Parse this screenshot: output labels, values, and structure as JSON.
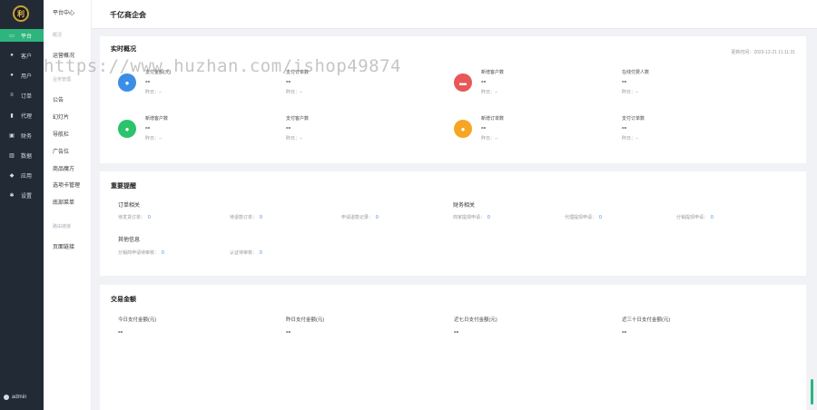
{
  "nav": {
    "logo_text": "利",
    "items": [
      {
        "label": "平台",
        "icon": "monitor-icon"
      },
      {
        "label": "客户",
        "icon": "user-icon"
      },
      {
        "label": "用户",
        "icon": "users-icon"
      },
      {
        "label": "订单",
        "icon": "list-icon"
      },
      {
        "label": "代理",
        "icon": "flag-icon"
      },
      {
        "label": "财务",
        "icon": "wallet-icon"
      },
      {
        "label": "数据",
        "icon": "chart-icon"
      },
      {
        "label": "应用",
        "icon": "apps-icon"
      },
      {
        "label": "设置",
        "icon": "gear-icon"
      }
    ],
    "user": "admin"
  },
  "submenu": {
    "top": "平台中心",
    "group1": "概况",
    "overview": "运营概况",
    "group2": "业务管理",
    "items": [
      "公告",
      "幻灯片",
      "导航栏",
      "广告位",
      "商品魔方",
      "选项卡管理",
      "底部菜单"
    ],
    "group3": "路由链接",
    "link": "页面链接"
  },
  "header": {
    "title": "千亿商企会"
  },
  "realtime": {
    "title": "实时概况",
    "updated": "更新时间：2023-12-21 11:11:31",
    "stats": [
      {
        "label": "支付金额(元)",
        "value": "--",
        "yesterday": "昨日：--",
        "icon": "money-bag-icon",
        "color": "#3a8ee6"
      },
      {
        "label": "支付订单数",
        "value": "--",
        "yesterday": "昨日：--"
      },
      {
        "label": "新增客户数",
        "value": "--",
        "yesterday": "昨日：--",
        "icon": "store-icon",
        "color": "#e85858"
      },
      {
        "label": "在线付费人数",
        "value": "--",
        "yesterday": "昨日：--"
      },
      {
        "label": "新增客户数",
        "value": "--",
        "yesterday": "昨日：--",
        "icon": "person-icon",
        "color": "#2bc36b"
      },
      {
        "label": "支付客户数",
        "value": "--",
        "yesterday": "昨日：--"
      },
      {
        "label": "新增订单数",
        "value": "--",
        "yesterday": "昨日：--",
        "icon": "people-icon",
        "color": "#f5a623"
      },
      {
        "label": "支付订单数",
        "value": "--",
        "yesterday": "昨日：--"
      }
    ]
  },
  "reminder": {
    "title": "重要提醒",
    "order_title": "订单相关",
    "order_items": [
      {
        "label": "待发货订单：",
        "value": "0"
      },
      {
        "label": "待退款订单：",
        "value": "0"
      },
      {
        "label": "申请退款记录：",
        "value": "0"
      }
    ],
    "finance_title": "财务相关",
    "finance_items": [
      {
        "label": "商家提现申请：",
        "value": "0"
      },
      {
        "label": "代理提现申请：",
        "value": "0"
      },
      {
        "label": "分销提现申请：",
        "value": "0"
      }
    ],
    "other_title": "其他信息",
    "other_items": [
      {
        "label": "分销商申请待审核：",
        "value": "0"
      },
      {
        "label": "认证待审核：",
        "value": "0"
      }
    ]
  },
  "trade": {
    "title": "交易金额",
    "items": [
      {
        "label": "今日支付金额(元)",
        "value": "--"
      },
      {
        "label": "昨日支付金额(元)",
        "value": "--"
      },
      {
        "label": "近七日支付金额(元)",
        "value": "--"
      },
      {
        "label": "近三十日支付金额(元)",
        "value": "--"
      }
    ]
  },
  "watermark": "https://www.huzhan.com/ishop49874"
}
